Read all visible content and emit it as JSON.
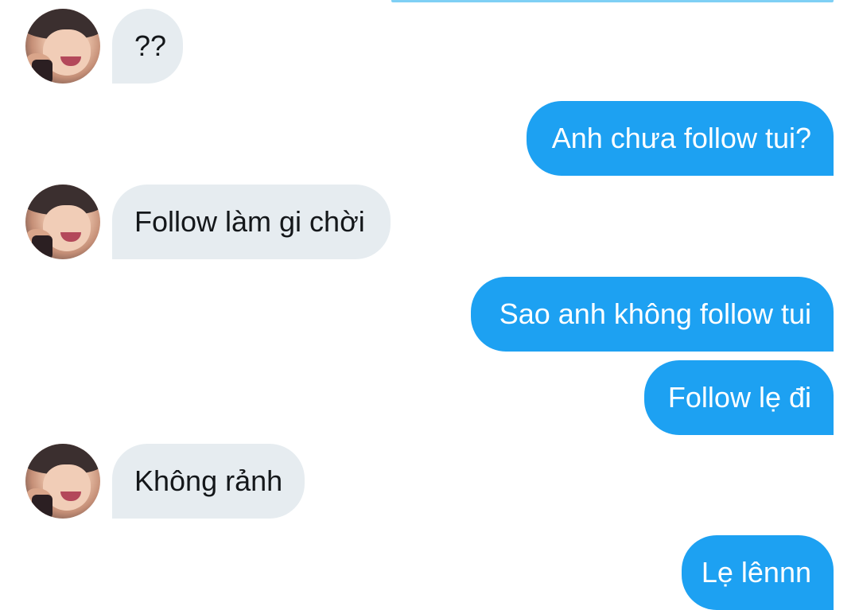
{
  "chat": {
    "incoming_1": "??",
    "outgoing_1": "Anh chưa follow tui?",
    "incoming_2": "Follow làm gi chời",
    "outgoing_2": "Sao anh không follow tui",
    "outgoing_3": "Follow lẹ đi",
    "incoming_3": "Không rảnh",
    "outgoing_4": "Lẹ lênnn"
  },
  "colors": {
    "outgoing_bubble": "#1da1f2",
    "incoming_bubble": "#e6ecf0",
    "background": "#ffffff"
  }
}
